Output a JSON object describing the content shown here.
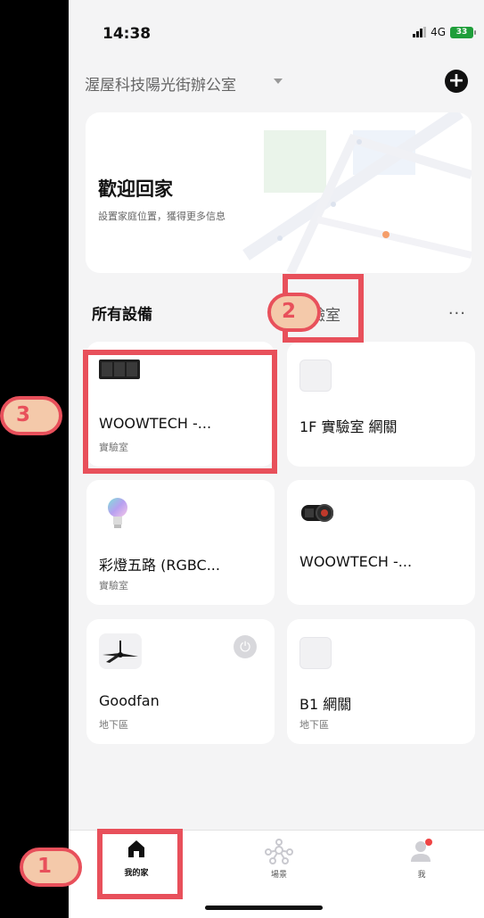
{
  "status": {
    "time": "14:38",
    "network": "4G",
    "battery": "33"
  },
  "header": {
    "home_name": "渥屋科技陽光街辦公室"
  },
  "welcome": {
    "title": "歡迎回家",
    "subtitle": "設置家庭位置，獲得更多信息"
  },
  "section": {
    "all_devices": "所有設備",
    "room_tab": "實驗室",
    "more": "..."
  },
  "devices": [
    {
      "name": "WOOWTECH -...",
      "room": "實驗室",
      "icon": "wall-switch-icon"
    },
    {
      "name": "1F 實驗室 網關",
      "room": "",
      "icon": "gateway-icon"
    },
    {
      "name": "彩燈五路 (RGBC...",
      "room": "實驗室",
      "icon": "bulb-icon"
    },
    {
      "name": "WOOWTECH -...",
      "room": "",
      "icon": "spotlight-icon"
    },
    {
      "name": "Goodfan",
      "room": "地下區",
      "icon": "ceiling-fan-icon"
    },
    {
      "name": "B1 網關",
      "room": "地下區",
      "icon": "gateway-icon"
    }
  ],
  "tabbar": {
    "home": "我的家",
    "scenes": "場景",
    "me": "我"
  },
  "annotations": {
    "one": "1",
    "two": "2",
    "three": "3"
  },
  "colors": {
    "highlight": "#e8505b",
    "badge_fill": "#f4c9aa",
    "battery": "#1f9e3a",
    "notification_dot": "#ef4444"
  }
}
